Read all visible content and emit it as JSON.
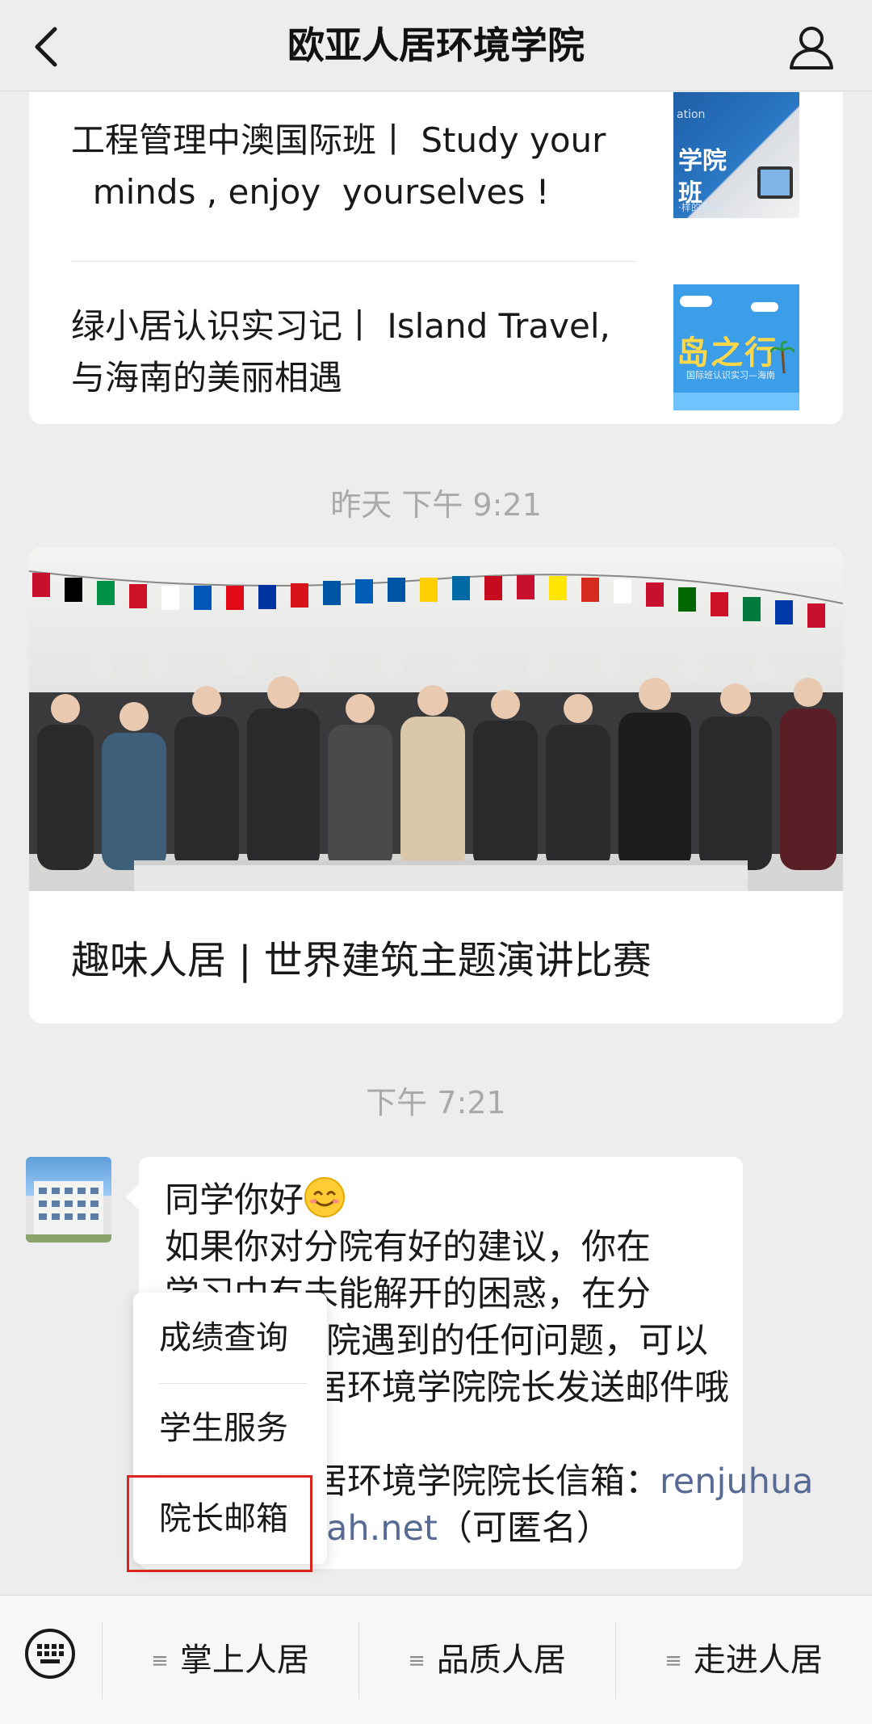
{
  "header": {
    "title": "欧亚人居环境学院",
    "back_icon": "chevron-left-icon",
    "profile_icon": "person-icon"
  },
  "articles": [
    {
      "title_line1": "工程管理中澳国际班丨 Study  your",
      "title_line2": "  minds , enjoy  yourselves !",
      "thumb_text1": "学院",
      "thumb_text2": "班",
      "thumb_text3": "ation",
      "thumb_text4": "·样的体验。"
    },
    {
      "title_line1": "绿小居认识实习记丨 Island Travel,",
      "title_line2": "与海南的美丽相遇",
      "thumb_text1": "岛之行",
      "thumb_text2": "国际班认识实习—海南"
    }
  ],
  "timestamps": {
    "first": "昨天 下午 9:21",
    "second": "下午 7:21"
  },
  "feature_article": {
    "title": "趣味人居 | 世界建筑主题演讲比赛"
  },
  "message": {
    "lines": [
      "同学你好",
      "如果你对分院有好的建议，你在",
      "学习中有未能解开的困惑，在分",
      "院遇到的任何问题，可以",
      "人居环境学院院长发送邮件哦",
      "",
      "人居环境学院院长信箱：",
      "（可匿名）"
    ],
    "emoji": "smile-emoji",
    "email_part1": "renjuhua",
    "email_part2": "ah.net"
  },
  "popup_menu": {
    "items": [
      "成绩查询",
      "学生服务",
      "院长邮箱"
    ],
    "highlighted": "院长邮箱",
    "highlight_color": "#d9251d"
  },
  "bottom_menu": {
    "keyboard_icon": "keyboard-icon",
    "items": [
      "掌上人居",
      "品质人居",
      "走进人居"
    ],
    "glyph": "≡"
  },
  "colors": {
    "background": "#ededed",
    "card": "#ffffff",
    "link": "#576b95",
    "timestamp": "#a9a9a9"
  }
}
